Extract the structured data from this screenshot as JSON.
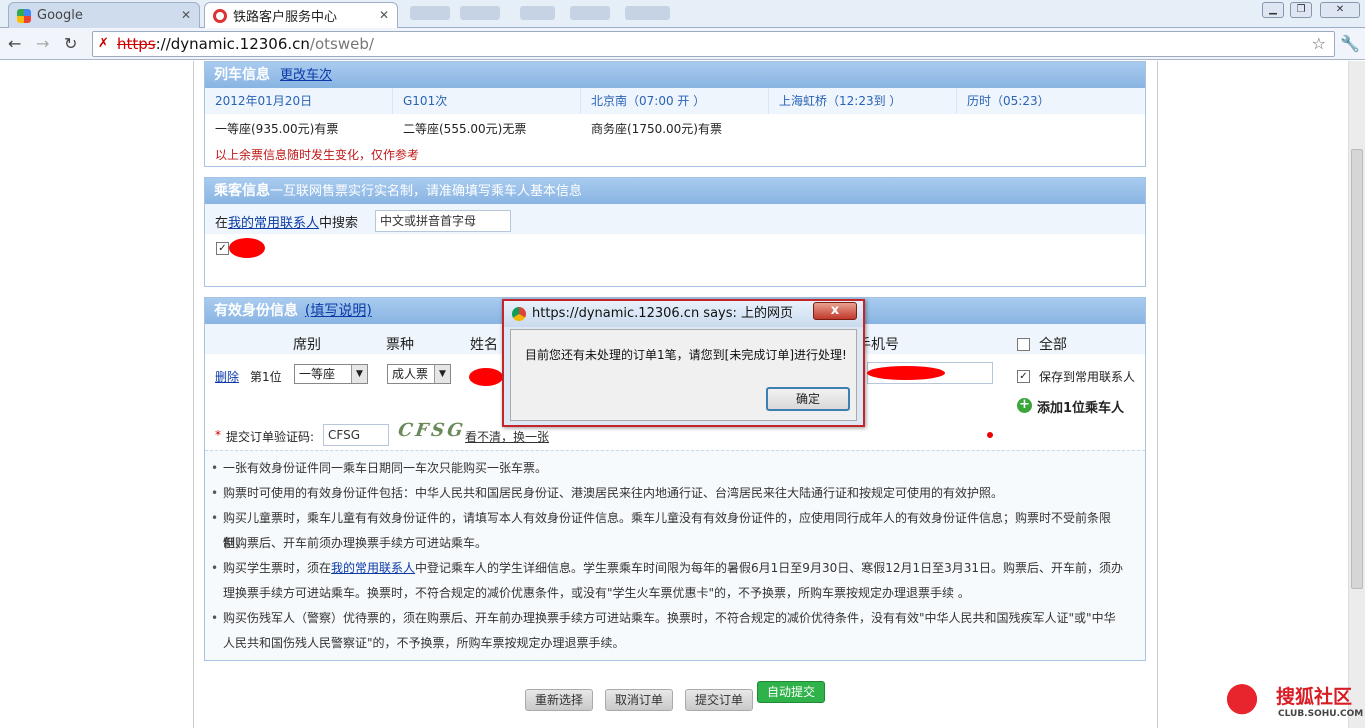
{
  "browser": {
    "tabs": [
      {
        "label": "Google"
      },
      {
        "label": "铁路客户服务中心"
      }
    ],
    "url_scheme": "https",
    "url_sep": "://",
    "url_domain": "dynamic.12306.cn",
    "url_path": "/otsweb/"
  },
  "train": {
    "header": "列车信息",
    "change_link": "更改车次",
    "date": "2012年01月20日",
    "train_no": "G101次",
    "from": "北京南（07:00 开 ）",
    "to": "上海虹桥（12:23到 ）",
    "duration": "历时（05:23）",
    "seats": [
      "一等座(935.00元)有票",
      "二等座(555.00元)无票",
      "商务座(1750.00元)有票"
    ],
    "notice": "以上余票信息随时发生变化，仅作参考"
  },
  "passenger": {
    "header": "乘客信息",
    "subheader": "一互联网售票实行实名制，请准确填写乘车人基本信息",
    "search_prefix": "在",
    "search_link": "我的常用联系人",
    "search_suffix": "中搜索",
    "search_placeholder": "中文或拼音首字母"
  },
  "id_info": {
    "header": "有效身份信息",
    "help_link": "(填写说明)",
    "col_seat": "席别",
    "col_ticket": "票种",
    "col_name": "姓名",
    "col_phone": "手机号",
    "all_label": "全部",
    "delete_link": "删除",
    "position": "第1位",
    "seat_value": "一等座",
    "ticket_value": "成人票",
    "save_contact": "保存到常用联系人",
    "add_passenger": "添加1位乘车人",
    "captcha_label": "提交订单验证码:",
    "captcha_value": "CFSG",
    "captcha_image_text": "CFSG",
    "captcha_refresh": "看不清，换一张"
  },
  "notes": [
    "一张有效身份证件同一乘车日期同一车次只能购买一张车票。",
    "购票时可使用的有效身份证件包括：中华人民共和国居民身份证、港澳居民来往内地通行证、台湾居民来往大陆通行证和按规定可使用的有效护照。",
    "购买儿童票时，乘车儿童有有效身份证件的，请填写本人有效身份证件信息。乘车儿童没有有效身份证件的，应使用同行成年人的有效身份证件信息；购票时不受前条限制，",
    "但购票后、开车前须办理换票手续方可进站乘车。",
    "购买学生票时，须在",
    "我的常用联系人",
    "中登记乘车人的学生详细信息。学生票乘车时间限为每年的暑假6月1日至9月30日、寒假12月1日至3月31日。购票后、开车前，须办",
    "理换票手续方可进站乘车。换票时，不符合规定的减价优惠条件，或没有\"学生火车票优惠卡\"的，不予换票，所购车票按规定办理退票手续 。",
    "购买伤残军人（警察）优待票的，须在购票后、开车前办理换票手续方可进站乘车。换票时，不符合规定的减价优待条件，没有有效\"中华人民共和国残疾军人证\"或\"中华",
    "人民共和国伤残人民警察证\"的，不予换票，所购车票按规定办理退票手续。"
  ],
  "buttons": {
    "reselect": "重新选择",
    "cancel": "取消订单",
    "submit": "提交订单",
    "auto_submit": "自动提交"
  },
  "dialog": {
    "title": "https://dynamic.12306.cn says: 上的网页",
    "close": "x",
    "message": "目前您还有未处理的订单1笔，请您到[未完成订单]进行处理!",
    "ok": "确定"
  },
  "watermark": {
    "brand": "搜狐社区",
    "domain": "CLUB.SOHU.COM"
  },
  "colors": {
    "panel_header": "#88b4e2",
    "link_blue": "#2a63b6",
    "warn_red": "#c01818",
    "auto_submit_green": "#2fb24a"
  }
}
